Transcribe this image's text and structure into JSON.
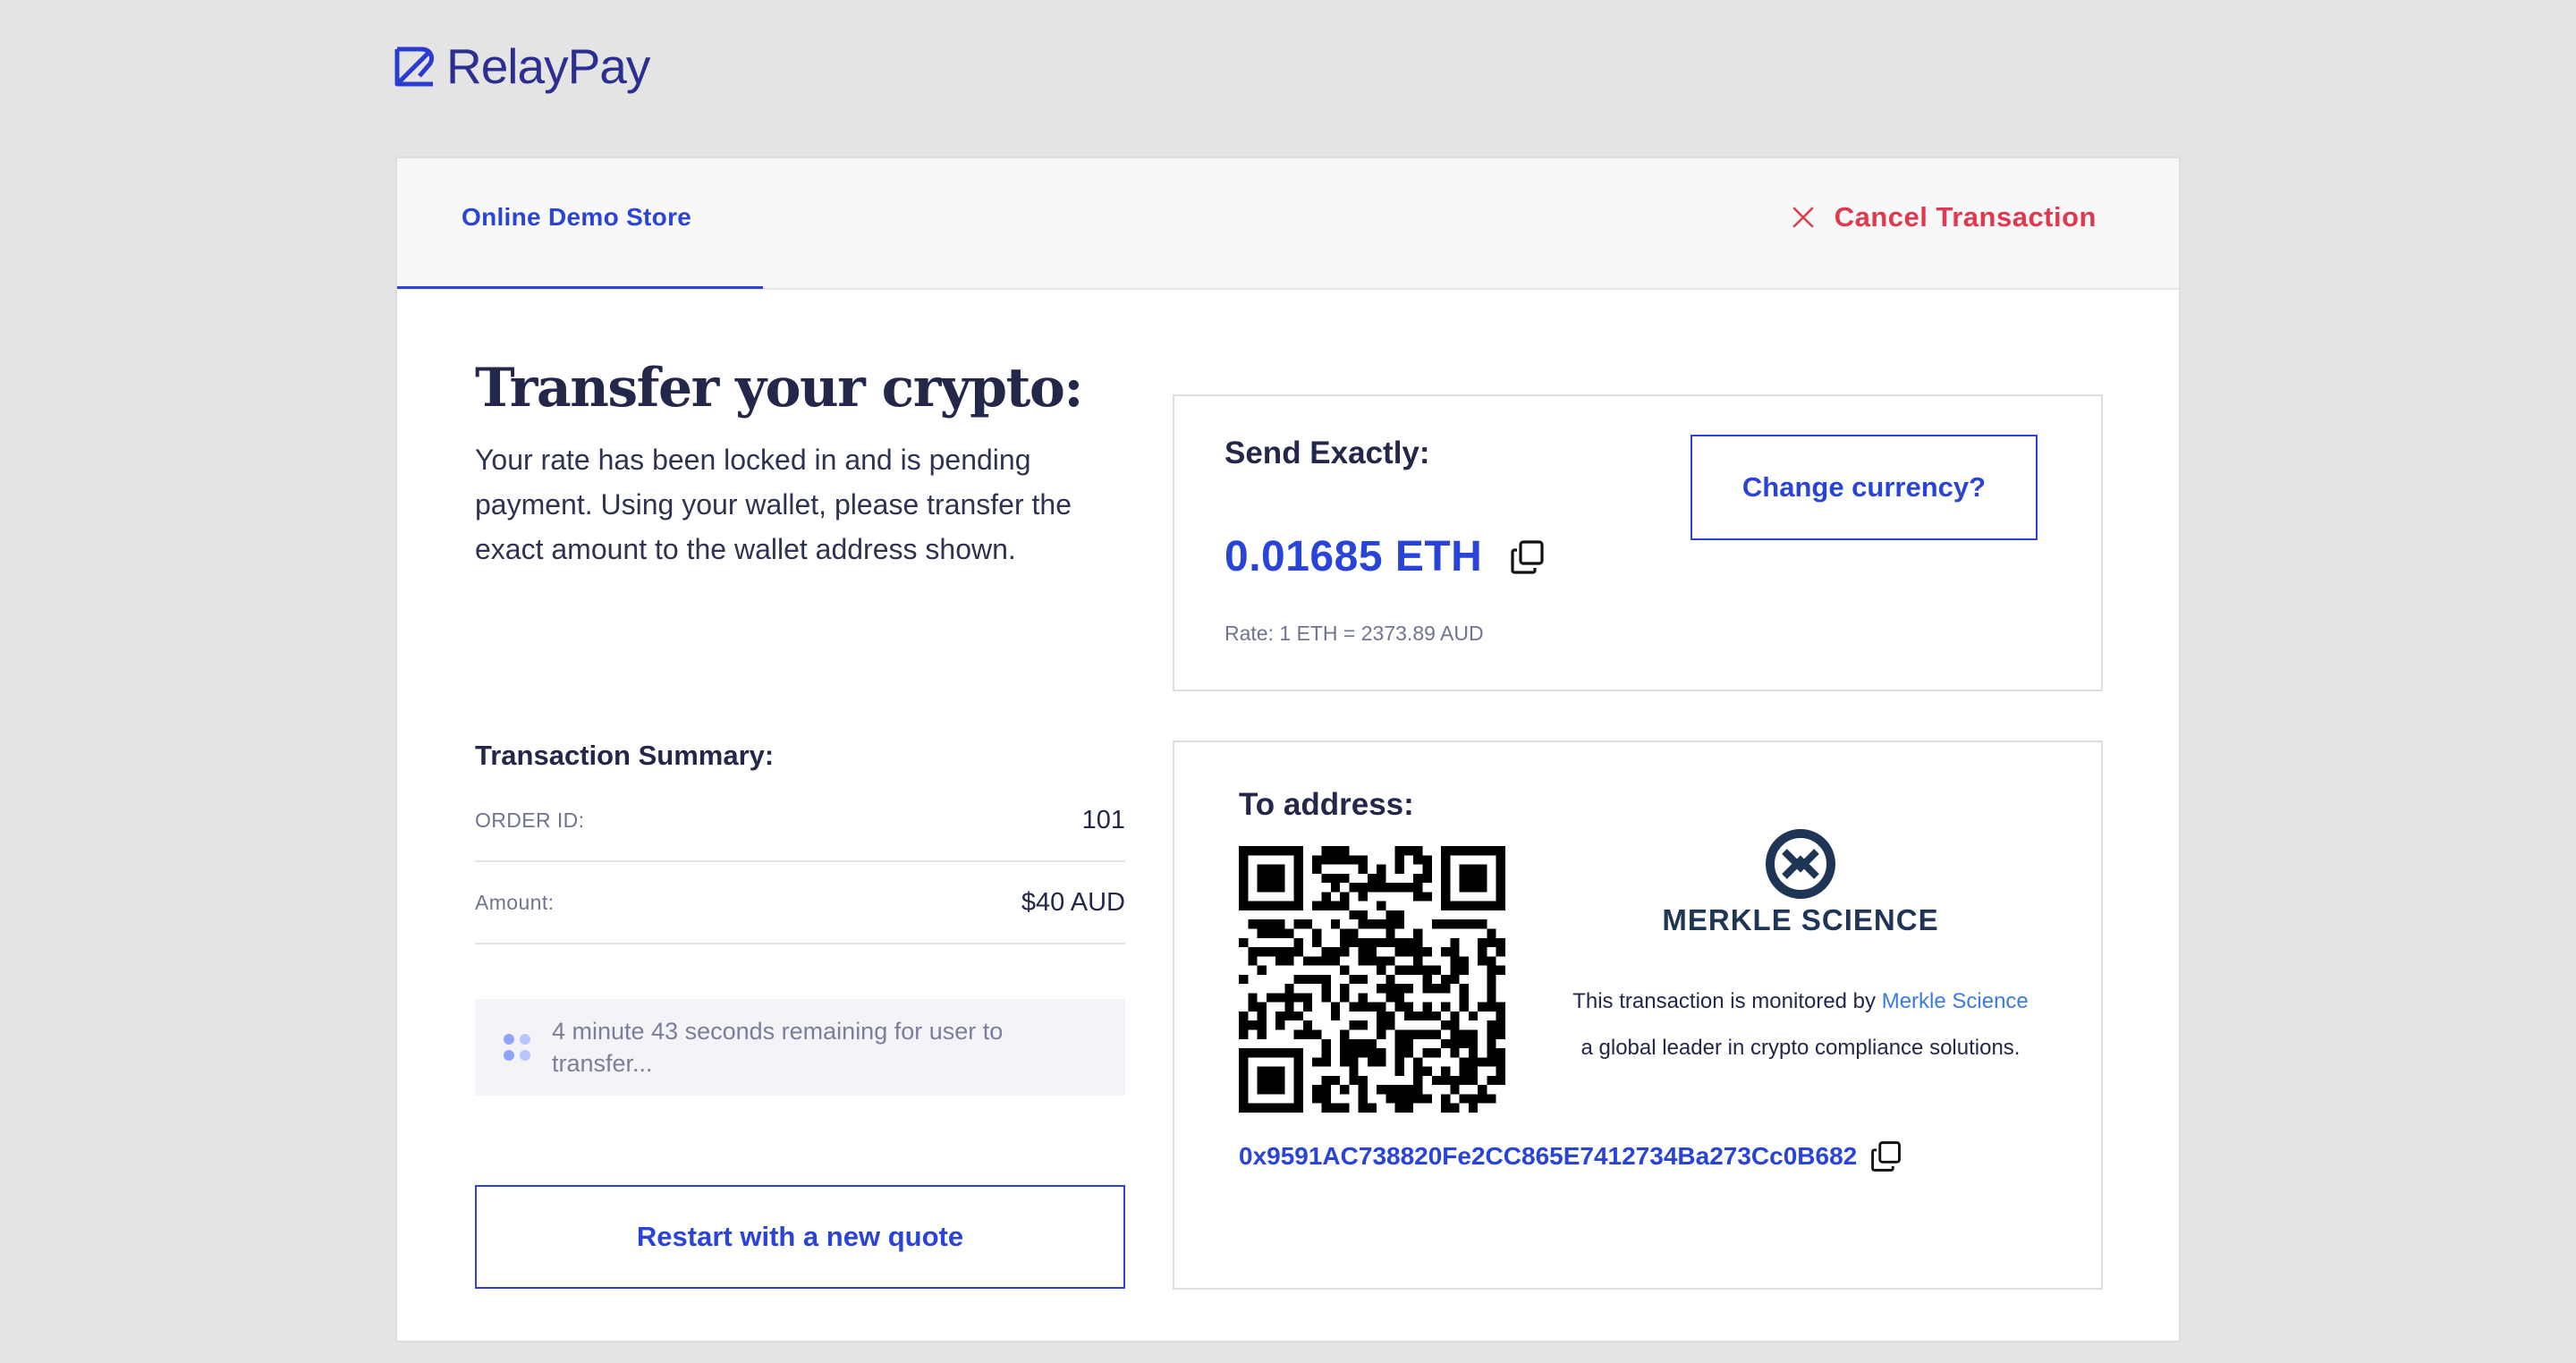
{
  "brand": {
    "name": "RelayPay",
    "color": "#2b2f8f"
  },
  "header": {
    "store_tab": "Online Demo Store",
    "cancel_label": "Cancel Transaction"
  },
  "main": {
    "title": "Transfer your crypto:",
    "subtitle": "Your rate has been locked in and is pending payment. Using your wallet, please transfer the exact amount to the wallet address shown."
  },
  "send": {
    "label": "Send Exactly:",
    "amount": "0.01685 ETH",
    "rate": "Rate: 1 ETH = 2373.89 AUD",
    "change_label": "Change currency?"
  },
  "summary": {
    "title": "Transaction Summary:",
    "rows": [
      {
        "key": "ORDER ID:",
        "value": "101"
      },
      {
        "key": "Amount:",
        "value": "$40 AUD"
      }
    ],
    "timer": "4 minute 43 seconds remaining for user to transfer...",
    "restart_label": "Restart with a new quote"
  },
  "address": {
    "label": "To address:",
    "wallet": "0x9591AC738820Fe2CC865E7412734Ba273Cc0B682",
    "monitor_brand": "MERKLE SCIENCE",
    "monitor_prefix": "This transaction is monitored by",
    "monitor_link": "Merkle Science",
    "monitor_suffix": "a global leader in crypto compliance solutions."
  },
  "colors": {
    "accent": "#2a43d9",
    "danger": "#e0394f",
    "text": "#23274a"
  },
  "icons": [
    "logo-mark-icon",
    "close-icon",
    "copy-icon",
    "qr-code-icon",
    "merkle-logo-icon",
    "loading-dots-icon"
  ]
}
